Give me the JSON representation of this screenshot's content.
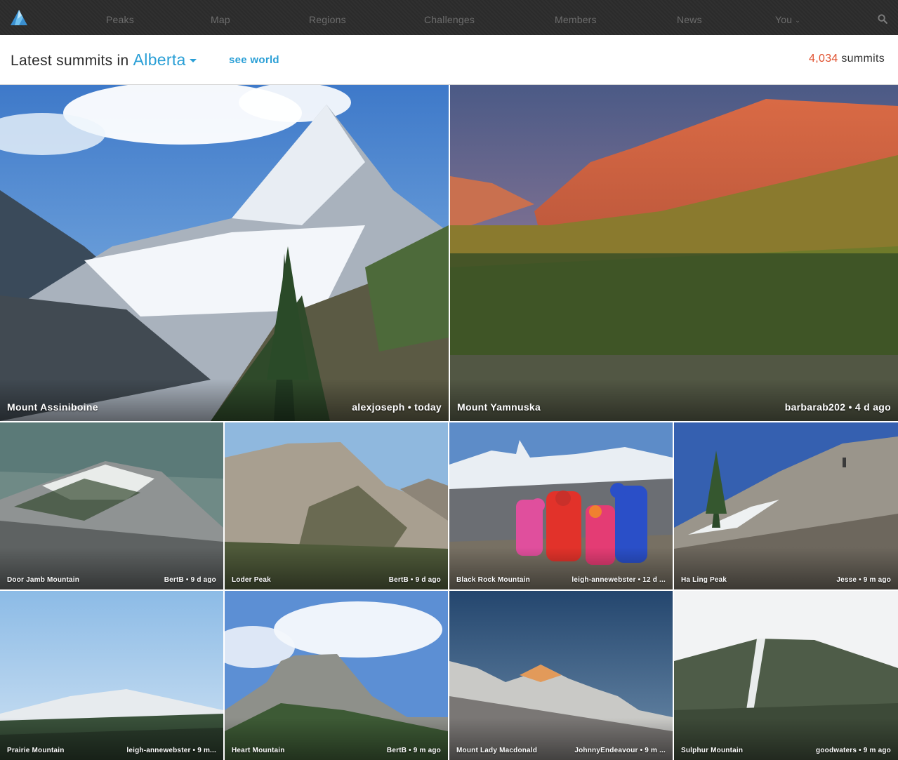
{
  "nav": {
    "items": [
      "Peaks",
      "Map",
      "Regions",
      "Challenges",
      "Members",
      "News"
    ],
    "you_label": "You",
    "you_caret_icon": "chevron-down-icon",
    "search_icon": "search-icon",
    "logo_icon": "peakery-logo-icon"
  },
  "header": {
    "title_prefix": "Latest summits in",
    "region": "Alberta",
    "see_world": "see world",
    "count_value": "4,034",
    "count_label": "summits"
  },
  "colors": {
    "accent": "#2a9fd6",
    "count": "#e0512f",
    "nav_bg": "#2b2b2b",
    "nav_text": "#6d6d6d"
  },
  "summits": [
    {
      "name": "Mount Assiniboine",
      "meta": "alexjoseph • today"
    },
    {
      "name": "Mount Yamnuska",
      "meta": "barbarab202 • 4 d ago"
    },
    {
      "name": "Door Jamb Mountain",
      "meta": "BertB • 9 d ago"
    },
    {
      "name": "Loder Peak",
      "meta": "BertB • 9 d ago"
    },
    {
      "name": "Black Rock Mountain",
      "meta": "leigh-annewebster • 12 d ..."
    },
    {
      "name": "Ha Ling Peak",
      "meta": "Jesse • 9 m ago"
    },
    {
      "name": "Prairie Mountain",
      "meta": "leigh-annewebster • 9 m..."
    },
    {
      "name": "Heart Mountain",
      "meta": "BertB • 9 m ago"
    },
    {
      "name": "Mount Lady Macdonald",
      "meta": "JohnnyEndeavour • 9 m ..."
    },
    {
      "name": "Sulphur Mountain",
      "meta": "goodwaters • 9 m ago"
    }
  ]
}
